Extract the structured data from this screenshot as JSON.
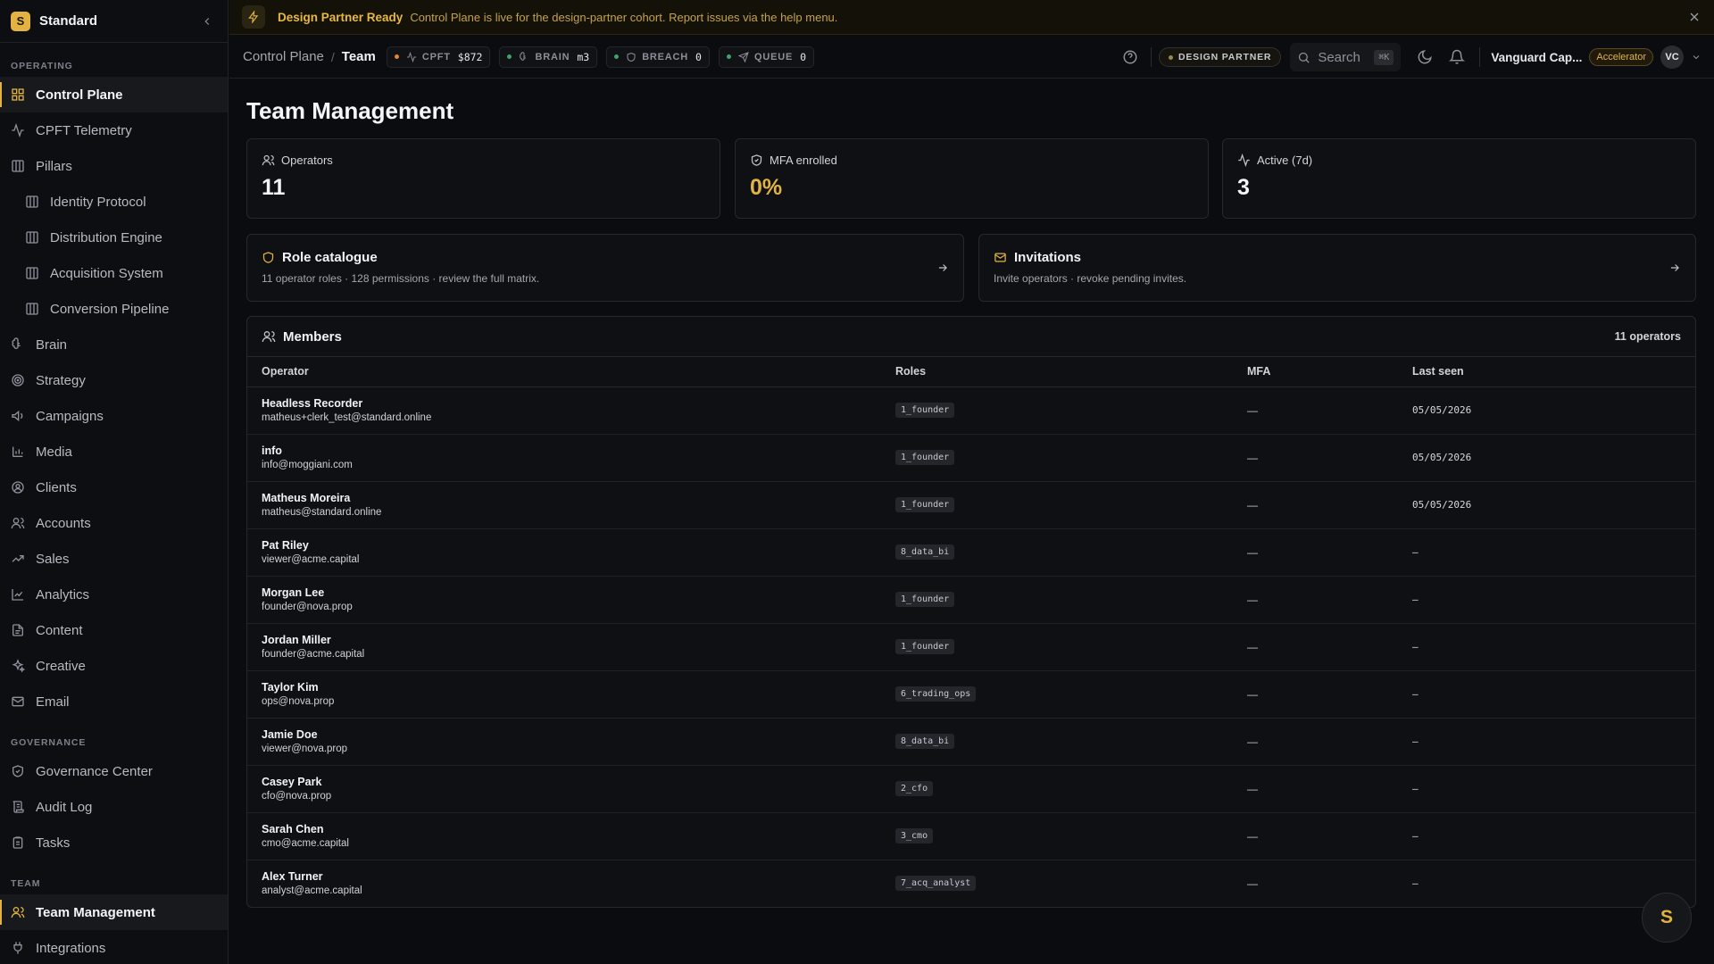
{
  "app": {
    "name": "Standard",
    "logo_letter": "S"
  },
  "sidebar": {
    "sections": [
      {
        "label": "OPERATING"
      },
      {
        "label": "GOVERNANCE"
      },
      {
        "label": "TEAM"
      }
    ],
    "items": [
      {
        "label": "Control Plane",
        "icon": "grid-icon"
      },
      {
        "label": "CPFT Telemetry",
        "icon": "activity-icon"
      },
      {
        "label": "Pillars",
        "icon": "columns-icon"
      },
      {
        "label": "Identity Protocol",
        "icon": "columns-icon"
      },
      {
        "label": "Distribution Engine",
        "icon": "columns-icon"
      },
      {
        "label": "Acquisition System",
        "icon": "columns-icon"
      },
      {
        "label": "Conversion Pipeline",
        "icon": "columns-icon"
      },
      {
        "label": "Brain",
        "icon": "brain-icon"
      },
      {
        "label": "Strategy",
        "icon": "target-icon"
      },
      {
        "label": "Campaigns",
        "icon": "megaphone-icon"
      },
      {
        "label": "Media",
        "icon": "bar-chart-icon"
      },
      {
        "label": "Clients",
        "icon": "user-circle-icon"
      },
      {
        "label": "Accounts",
        "icon": "users-icon"
      },
      {
        "label": "Sales",
        "icon": "trending-up-icon"
      },
      {
        "label": "Analytics",
        "icon": "line-chart-icon"
      },
      {
        "label": "Content",
        "icon": "file-text-icon"
      },
      {
        "label": "Creative",
        "icon": "sparkles-icon"
      },
      {
        "label": "Email",
        "icon": "mail-icon"
      },
      {
        "label": "Governance Center",
        "icon": "shield-check-icon"
      },
      {
        "label": "Audit Log",
        "icon": "scroll-icon"
      },
      {
        "label": "Tasks",
        "icon": "clipboard-icon"
      },
      {
        "label": "Team Management",
        "icon": "users-icon"
      },
      {
        "label": "Integrations",
        "icon": "plug-icon"
      }
    ]
  },
  "banner": {
    "title": "Design Partner Ready",
    "text": "Control Plane is live for the design-partner cohort. Report issues via the help menu."
  },
  "topbar": {
    "breadcrumb": [
      "Control Plane",
      "Team"
    ],
    "chips": [
      {
        "key": "CPFT",
        "value": "$872",
        "dot_color": "#e0892f"
      },
      {
        "key": "BRAIN",
        "value": "m3",
        "dot_color": "#3fa36a"
      },
      {
        "key": "BREACH",
        "value": "0",
        "dot_color": "#3fa36a"
      },
      {
        "key": "QUEUE",
        "value": "0",
        "dot_color": "#3fa36a"
      }
    ],
    "partner_badge": "DESIGN PARTNER",
    "search_placeholder": "Search",
    "search_shortcut": "⌘K",
    "org_name": "Vanguard Cap...",
    "plan": "Accelerator",
    "avatar": "VC"
  },
  "page": {
    "title": "Team Management"
  },
  "stats": [
    {
      "label": "Operators",
      "value": "11"
    },
    {
      "label": "MFA enrolled",
      "value": "0%"
    },
    {
      "label": "Active (7d)",
      "value": "3"
    }
  ],
  "links": [
    {
      "title": "Role catalogue",
      "desc": "11 operator roles · 128 permissions · review the full matrix."
    },
    {
      "title": "Invitations",
      "desc": "Invite operators · revoke pending invites."
    }
  ],
  "members": {
    "title": "Members",
    "count": "11 operators",
    "columns": [
      "Operator",
      "Roles",
      "MFA",
      "Last seen"
    ],
    "rows": [
      {
        "name": "Headless Recorder",
        "email": "matheus+clerk_test@standard.online",
        "role": "1_founder",
        "mfa": "—",
        "last_seen": "05/05/2026"
      },
      {
        "name": "info",
        "email": "info@moggiani.com",
        "role": "1_founder",
        "mfa": "—",
        "last_seen": "05/05/2026"
      },
      {
        "name": "Matheus Moreira",
        "email": "matheus@standard.online",
        "role": "1_founder",
        "mfa": "—",
        "last_seen": "05/05/2026"
      },
      {
        "name": "Pat Riley",
        "email": "viewer@acme.capital",
        "role": "8_data_bi",
        "mfa": "—",
        "last_seen": "–"
      },
      {
        "name": "Morgan Lee",
        "email": "founder@nova.prop",
        "role": "1_founder",
        "mfa": "—",
        "last_seen": "–"
      },
      {
        "name": "Jordan Miller",
        "email": "founder@acme.capital",
        "role": "1_founder",
        "mfa": "—",
        "last_seen": "–"
      },
      {
        "name": "Taylor Kim",
        "email": "ops@nova.prop",
        "role": "6_trading_ops",
        "mfa": "—",
        "last_seen": "–"
      },
      {
        "name": "Jamie Doe",
        "email": "viewer@nova.prop",
        "role": "8_data_bi",
        "mfa": "—",
        "last_seen": "–"
      },
      {
        "name": "Casey Park",
        "email": "cfo@nova.prop",
        "role": "2_cfo",
        "mfa": "—",
        "last_seen": "–"
      },
      {
        "name": "Sarah Chen",
        "email": "cmo@acme.capital",
        "role": "3_cmo",
        "mfa": "—",
        "last_seen": "–"
      },
      {
        "name": "Alex Turner",
        "email": "analyst@acme.capital",
        "role": "7_acq_analyst",
        "mfa": "—",
        "last_seen": "–"
      }
    ]
  },
  "fab": {
    "label": "S"
  }
}
